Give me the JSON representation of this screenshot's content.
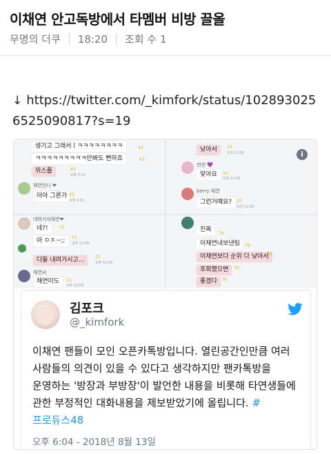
{
  "post": {
    "title": "이채연 안고독방에서 타멤버 비방 끌올",
    "author": "무명의 더쿠",
    "time": "18:20",
    "views": "조회 수 1"
  },
  "link": {
    "arrow_icon": "down-arrow-icon",
    "url": "https://twitter.com/_kimfork/status/1028930256525090817?s=19"
  },
  "chat_screenshot": {
    "info_icon": "i",
    "col1": {
      "messages": [
        {
          "text": "생기고 그래서ㅣㅋㅋㅋㅋㅋㅋㅋㅋ",
          "count": "43",
          "highlight": false
        },
        {
          "text": "ㅋㅋㅋㅋㅋㅋㅋㅋㅋ안봐도 뻔하죠",
          "count": "43",
          "highlight": false
        },
        {
          "text": "위스플",
          "count": "43",
          "time": "오후 3:31",
          "highlight": true
        },
        {
          "sender": "채연언니 ❤",
          "text": "아아 그론가",
          "count": "43",
          "time": "오후 3:31",
          "highlight": false
        },
        {
          "sender": "데뷔가자채연❤",
          "text": "네?!",
          "count": "11",
          "highlight": false
        },
        {
          "text": "아 ㅇㅈ~;;",
          "count": "11",
          "time": "오후 12:09",
          "highlight": false
        },
        {
          "text": "다들 내려가시고...",
          "count": "11",
          "time": "오후 12:09",
          "highlight": true
        },
        {
          "sender": "채연씨",
          "text": "채연이도",
          "count": "11",
          "time": "오후 12:09",
          "highlight": false
        }
      ]
    },
    "col2": {
      "messages": [
        {
          "text": "낮아서",
          "count": "10",
          "time": "오전 12:18",
          "highlight": true
        },
        {
          "sender": "썬썬 💜",
          "text": "맞아요",
          "count": "10",
          "time": "오전 12:18",
          "highlight": false
        },
        {
          "sender": "berry 채연",
          "text": "그런거예요?",
          "count": "10",
          "time": "오전 12:18",
          "highlight": false
        },
        {
          "text": "진짜",
          "count": "79",
          "highlight": false
        },
        {
          "text": "이채연내보낸팀",
          "count": "79",
          "highlight": false
        },
        {
          "text": "이채연보다 순위 다 낮아서",
          "count": "79",
          "highlight": true
        },
        {
          "text": "후회했으면",
          "count": "79",
          "highlight": true
        },
        {
          "text": "좋겠다",
          "count": "79",
          "highlight": true
        }
      ]
    }
  },
  "tweet": {
    "name": "김포크",
    "handle": "@_kimfork",
    "text": "이채연 팬들이 모인 오픈카톡방입니다. 열린공간인만큼 여러 사람들의 의견이 있을 수 있다고 생각하지만 팬카톡방을 운영하는 '방장과 부방장'이 발언한 내용을 비롯해 타연생들에 관한 부정적인 대화내용을 제보받았기에 올립니다.",
    "hashtag": "#프로듀스48",
    "timestamp": "오후 6:04 - 2018년 8월 13일",
    "bird_icon": "twitter-bird-icon",
    "colors": {
      "link": "#1b95e0",
      "brand": "#1da1f2"
    }
  }
}
